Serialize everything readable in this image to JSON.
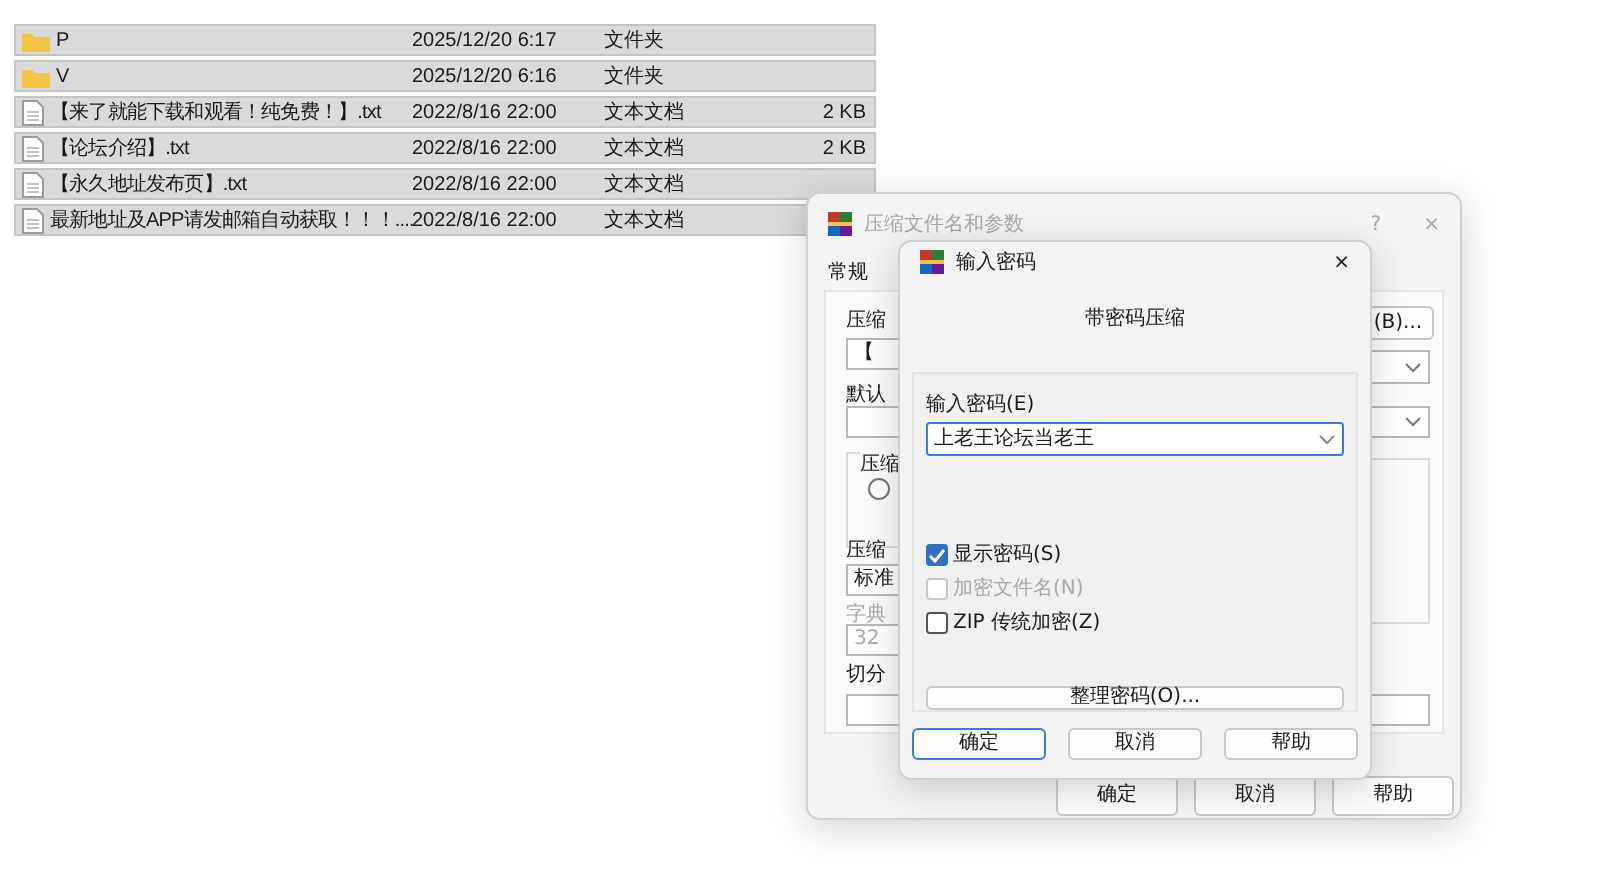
{
  "file_list": {
    "rows": [
      {
        "kind": "folder",
        "name": "P",
        "date": "2025/12/20 6:17",
        "type": "文件夹",
        "selected": true
      },
      {
        "kind": "folder",
        "name": "V",
        "date": "2025/12/20 6:16",
        "type": "文件夹",
        "selected": true
      },
      {
        "kind": "text",
        "name": "【来了就能下载和观看！纯免费！】.txt",
        "date": "2022/8/16 22:00",
        "type": "文本文档",
        "size": "2 KB",
        "selected": true
      },
      {
        "kind": "text",
        "name": "【论坛介绍】.txt",
        "date": "2022/8/16 22:00",
        "type": "文本文档",
        "size": "2 KB",
        "selected": true
      },
      {
        "kind": "text",
        "name": "【永久地址发布页】.txt",
        "date": "2022/8/16 22:00",
        "type": "文本文档",
        "selected": true
      },
      {
        "kind": "text",
        "name": "最新地址及APP请发邮箱自动获取！！！....",
        "date": "2022/8/16 22:00",
        "type": "文本文档",
        "selected": true
      }
    ]
  },
  "archive_dialog": {
    "title": "压缩文件名和参数",
    "help": "?",
    "close": "×",
    "tab": "常规",
    "parts": [
      {
        "kind": "label",
        "text": "压缩"
      },
      {
        "kind": "button",
        "text": "(B)..."
      },
      {
        "kind": "field",
        "text": "【"
      },
      {
        "kind": "dropdown"
      },
      {
        "kind": "label",
        "text": "默认"
      },
      {
        "kind": "field"
      },
      {
        "kind": "dropdown"
      },
      {
        "kind": "group",
        "text": "压缩"
      },
      {
        "kind": "radio",
        "checked": false
      },
      {
        "kind": "group"
      },
      {
        "kind": "label",
        "text": "压缩"
      },
      {
        "kind": "field",
        "text": "标准"
      },
      {
        "kind": "label",
        "text": "字典",
        "disabled": true
      },
      {
        "kind": "field",
        "text": "32",
        "disabled": true
      },
      {
        "kind": "label",
        "text": "切分"
      },
      {
        "kind": "field"
      },
      {
        "kind": "field"
      }
    ],
    "buttons": [
      "确定",
      "取消",
      "帮助"
    ]
  },
  "password_dialog": {
    "title": "输入密码",
    "close": "×",
    "heading": "带密码压缩",
    "password_label": "输入密码(E)",
    "password": "上老王论坛当老王",
    "options": [
      {
        "label": "显示密码(S)",
        "checked": true,
        "disabled": false
      },
      {
        "label": "加密文件名(N)",
        "checked": false,
        "disabled": true
      },
      {
        "label": "ZIP 传统加密(Z)",
        "checked": false,
        "disabled": false
      }
    ],
    "organize_button": "整理密码(O)...",
    "buttons": [
      {
        "label": "确定",
        "focused": true
      },
      {
        "label": "取消",
        "focused": false
      },
      {
        "label": "帮助",
        "focused": false
      }
    ]
  }
}
